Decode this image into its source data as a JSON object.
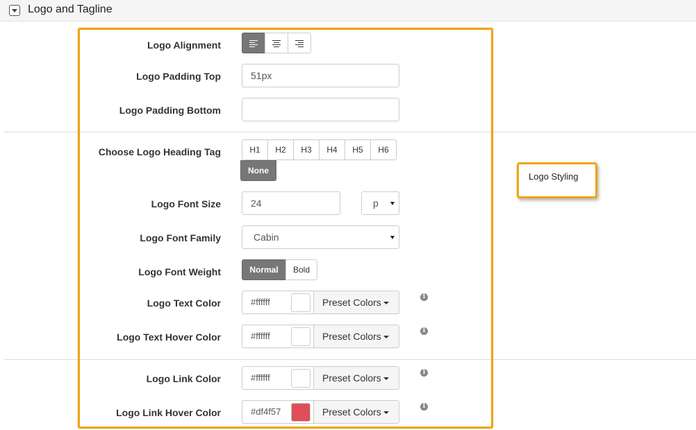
{
  "section": {
    "title": "Logo and Tagline"
  },
  "tooltip": "Logo Styling",
  "fields": {
    "logo_alignment": {
      "label": "Logo Alignment",
      "options": [
        "align-left-icon",
        "align-center-icon",
        "align-right-icon"
      ],
      "selected": "align-left-icon"
    },
    "logo_padding_top": {
      "label": "Logo Padding Top",
      "value": "51px"
    },
    "logo_padding_bottom": {
      "label": "Logo Padding Bottom",
      "value": ""
    },
    "logo_heading_tag": {
      "label": "Choose Logo Heading Tag",
      "options": [
        "H1",
        "H2",
        "H3",
        "H4",
        "H5",
        "H6",
        "None"
      ],
      "selected": "None"
    },
    "logo_font_size": {
      "label": "Logo Font Size",
      "value": "24",
      "unit": "p"
    },
    "logo_font_family": {
      "label": "Logo Font Family",
      "value": "Cabin"
    },
    "logo_font_weight": {
      "label": "Logo Font Weight",
      "options": [
        "Normal",
        "Bold"
      ],
      "selected": "Normal"
    },
    "logo_text_color": {
      "label": "Logo Text Color",
      "value": "#ffffff",
      "swatch": "#ffffff",
      "preset_label": "Preset Colors"
    },
    "logo_text_hover_color": {
      "label": "Logo Text Hover Color",
      "value": "#ffffff",
      "swatch": "#ffffff",
      "preset_label": "Preset Colors"
    },
    "logo_link_color": {
      "label": "Logo Link Color",
      "value": "#ffffff",
      "swatch": "#ffffff",
      "preset_label": "Preset Colors"
    },
    "logo_link_hover_color": {
      "label": "Logo Link Hover Color",
      "value": "#df4f57",
      "swatch": "#df4f57",
      "preset_label": "Preset Colors"
    }
  },
  "colors": {
    "highlight": "#f0a30a",
    "active_button": "#777777"
  }
}
